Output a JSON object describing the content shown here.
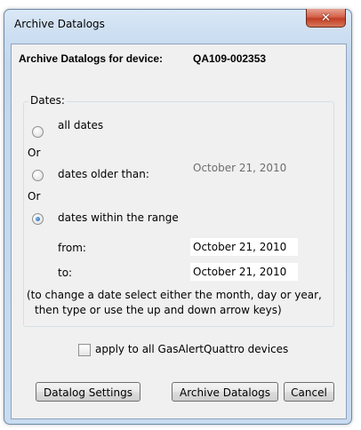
{
  "window": {
    "title": "Archive Datalogs",
    "close_glyph": "✕"
  },
  "header": {
    "label": "Archive Datalogs for device:",
    "device_id": "QA109-002353"
  },
  "dates_group": {
    "label": "Dates:",
    "option_all": "all dates",
    "or_1": "Or",
    "option_older": "dates older than:",
    "older_date": "October 21, 2010",
    "or_2": "Or",
    "option_range": "dates within the range",
    "selected_option": "dates within the range",
    "from_label": "from:",
    "from_date": "October 21, 2010",
    "to_label": "to:",
    "to_date": "October 21, 2010",
    "help_line1": "(to change a date select either the month, day or year,",
    "help_line2": "then type or use the up and down arrow keys)"
  },
  "apply_all": {
    "label": "apply to all GasAlertQuattro devices",
    "checked": false
  },
  "buttons": {
    "settings": "Datalog Settings",
    "archive": "Archive Datalogs",
    "cancel": "Cancel"
  }
}
